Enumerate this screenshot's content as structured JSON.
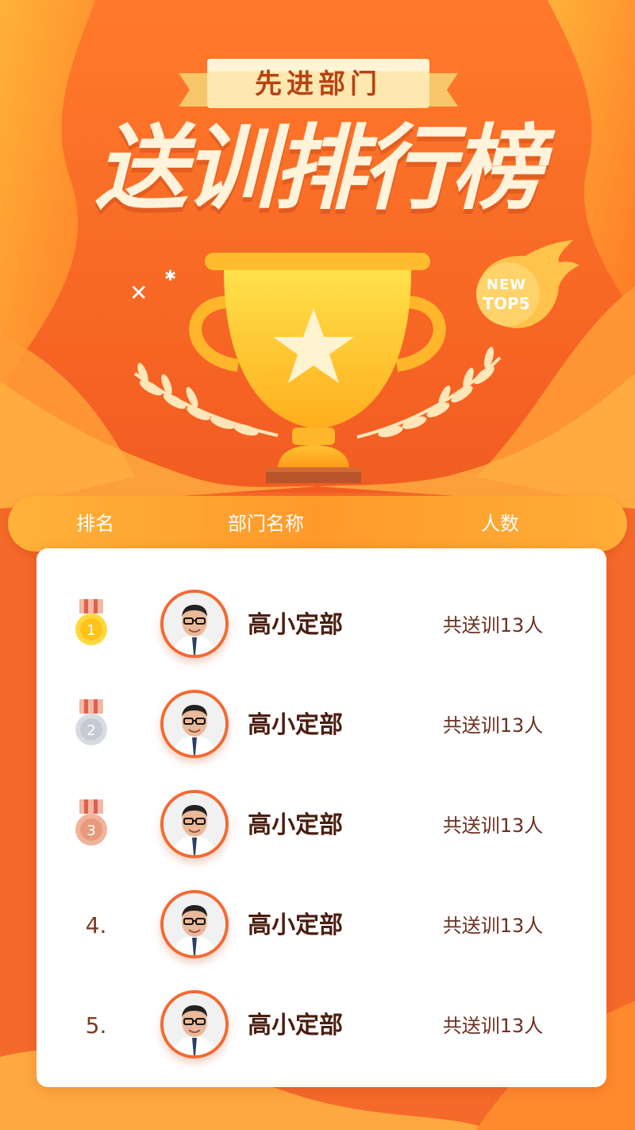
{
  "banner": {
    "ribbon_text": "先进部门",
    "main_title": "送训排行榜",
    "badge_new": "NEW",
    "badge_top": "TOP5"
  },
  "table": {
    "headers": {
      "rank": "排名",
      "dept": "部门名称",
      "count": "人数"
    },
    "rows": [
      {
        "rank": "1",
        "rank_type": "gold-medal",
        "dept": "高小定部",
        "count": "共送训13人"
      },
      {
        "rank": "2",
        "rank_type": "silver-medal",
        "dept": "高小定部",
        "count": "共送训13人"
      },
      {
        "rank": "3",
        "rank_type": "bronze-medal",
        "dept": "高小定部",
        "count": "共送训13人"
      },
      {
        "rank": "4.",
        "rank_type": "text",
        "dept": "高小定部",
        "count": "共送训13人"
      },
      {
        "rank": "5.",
        "rank_type": "text",
        "dept": "高小定部",
        "count": "共送训13人"
      }
    ]
  },
  "colors": {
    "background": "#f35a22",
    "accent": "#ff9a2a",
    "gold": "#ffd23a",
    "silver": "#c6cad3",
    "bronze": "#e89a7c",
    "title": "#fff3db"
  },
  "icons": [
    "trophy-icon",
    "star-icon",
    "laurel-icon",
    "flame-badge-icon",
    "medal-icon",
    "avatar-photo"
  ]
}
